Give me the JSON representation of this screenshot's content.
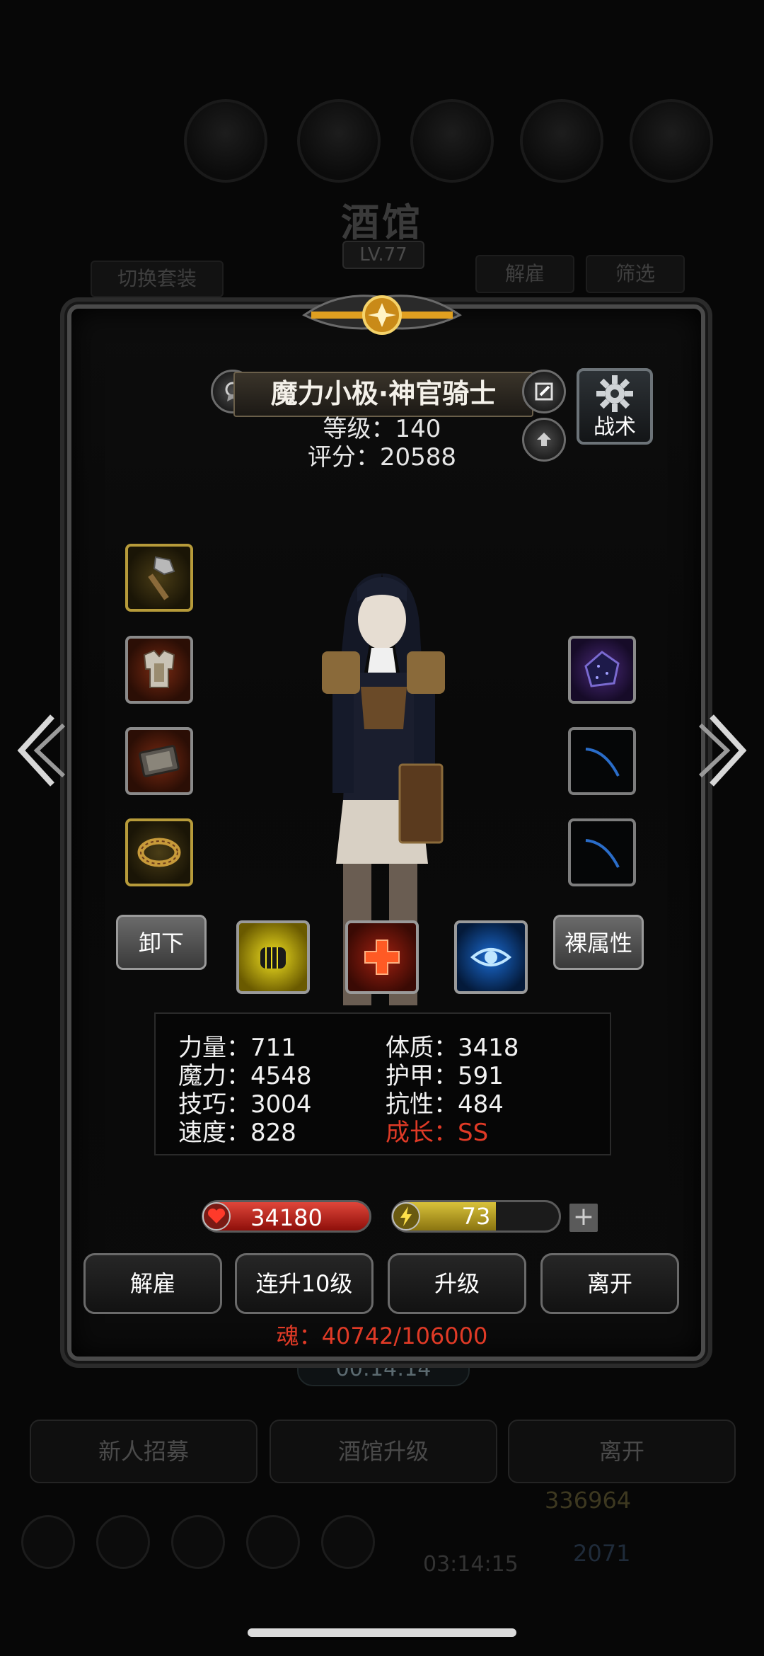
{
  "background": {
    "title": "酒馆",
    "level": "LV.77",
    "switch_outfit": "切换套装",
    "dismiss_top": "解雇",
    "filter": "筛选",
    "timer": "00:14:14",
    "recruit": "新人招募",
    "tavern_upgrade": "酒馆升级",
    "leave": "离开",
    "gold": "336964",
    "gems": "2071",
    "timer2": "03:14:15"
  },
  "hero": {
    "name": "魔力小极·神官骑士",
    "level_text": "等级：140",
    "score_text": "评分：20588",
    "tactics_label": "战术"
  },
  "actions": {
    "unequip": "卸下",
    "base_attr": "裸属性"
  },
  "stats": {
    "strength": "力量：711",
    "magic": "魔力：4548",
    "skill": "技巧：3004",
    "speed": "速度：828",
    "constitution": "体质：3418",
    "armor": "护甲：591",
    "resistance": "抗性：484",
    "growth": "成长：SS"
  },
  "bars": {
    "hp": "34180",
    "energy": "73",
    "energy_fraction": 0.62,
    "plus": "+"
  },
  "buttons": {
    "dismiss": "解雇",
    "level10": "连升10级",
    "levelup": "升级",
    "leave": "离开"
  },
  "soul": "魂：40742/106000",
  "colors": {
    "growth_red": "#e03a26",
    "hp_red": "#c8231a",
    "energy_yellow": "#d9c23a"
  }
}
